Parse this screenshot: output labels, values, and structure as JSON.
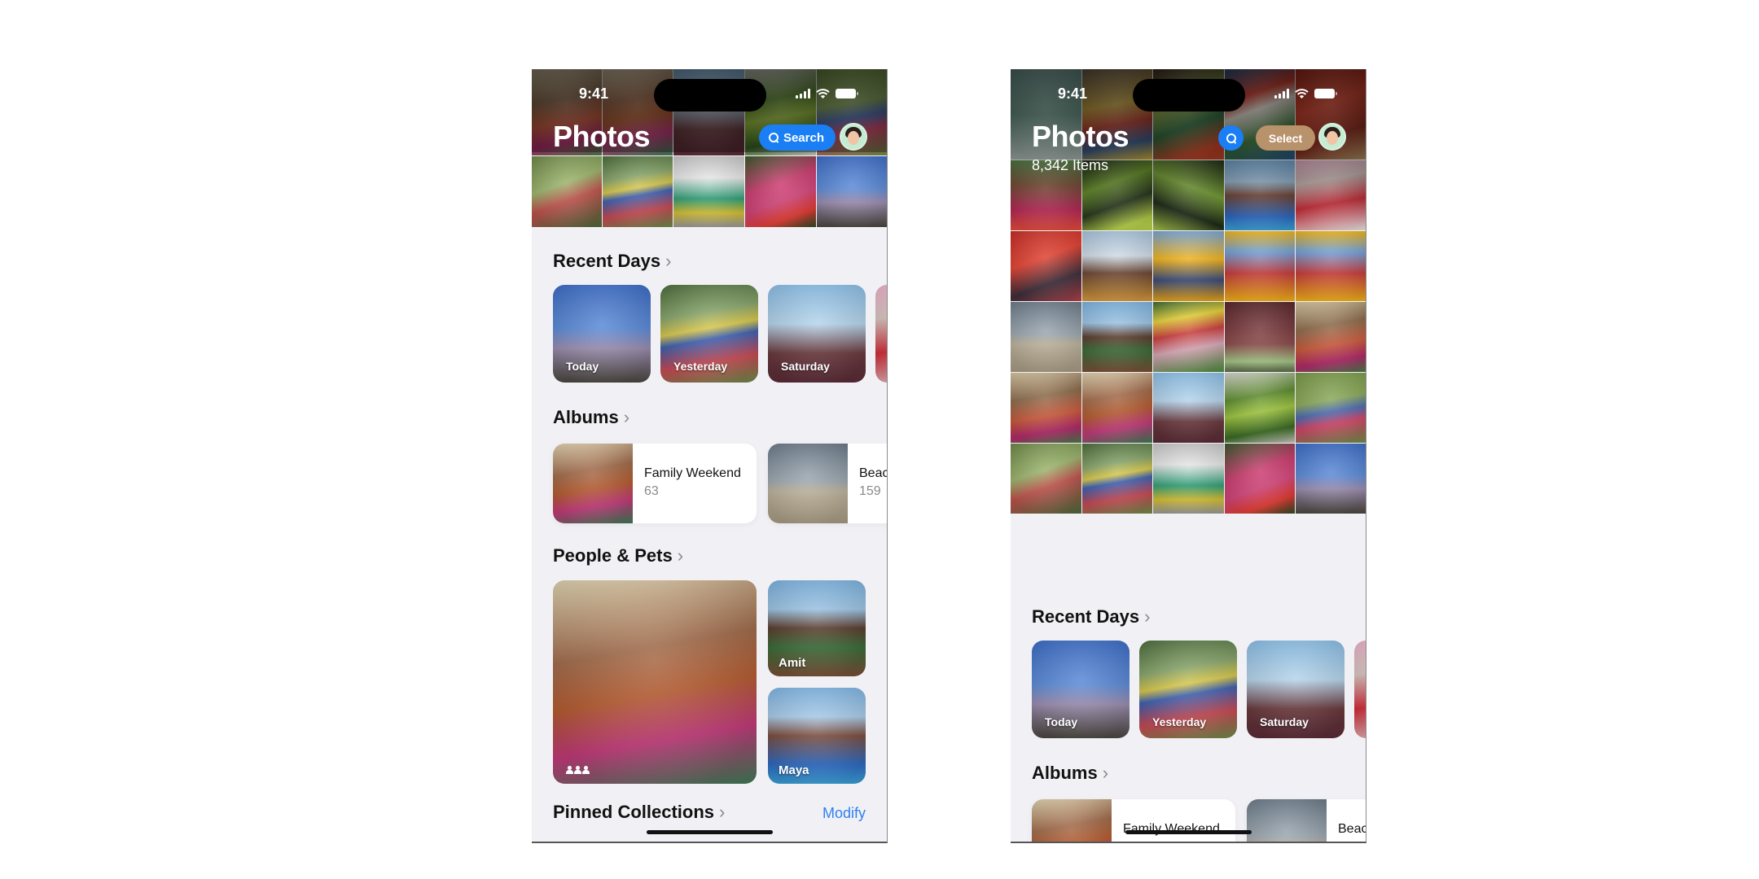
{
  "left_phone": {
    "status_bar": {
      "time": "9:41",
      "icons": [
        "signal-icon",
        "wifi-icon",
        "battery-icon"
      ]
    },
    "header": {
      "title": "Photos",
      "search_label": "Search"
    },
    "recent_days": {
      "title": "Recent Days",
      "cards": [
        {
          "label": "Today"
        },
        {
          "label": "Yesterday"
        },
        {
          "label": "Saturday"
        }
      ]
    },
    "albums": {
      "title": "Albums",
      "items": [
        {
          "name": "Family Weekend",
          "count": "63"
        },
        {
          "name": "Beac",
          "count": "159"
        }
      ]
    },
    "people_pets": {
      "title": "People & Pets",
      "people": [
        {
          "name": "Amit"
        },
        {
          "name": "Maya"
        }
      ]
    },
    "pinned_collections": {
      "title": "Pinned Collections",
      "action": "Modify"
    }
  },
  "right_phone": {
    "status_bar": {
      "time": "9:41",
      "icons": [
        "signal-icon",
        "wifi-icon",
        "battery-icon"
      ]
    },
    "header": {
      "title": "Photos",
      "item_count": "8,342 Items",
      "select_label": "Select"
    },
    "recent_days": {
      "title": "Recent Days",
      "cards": [
        {
          "label": "Today"
        },
        {
          "label": "Yesterday"
        },
        {
          "label": "Saturday"
        }
      ]
    },
    "albums": {
      "title": "Albums",
      "items": [
        {
          "name": "Family Weekend"
        },
        {
          "name": "Beac"
        }
      ]
    }
  },
  "colors": {
    "accent_blue": "#1a7ef5",
    "select_pill": "#b8926a",
    "link_blue": "#2f7ff0",
    "background": "#f1f1f5"
  }
}
